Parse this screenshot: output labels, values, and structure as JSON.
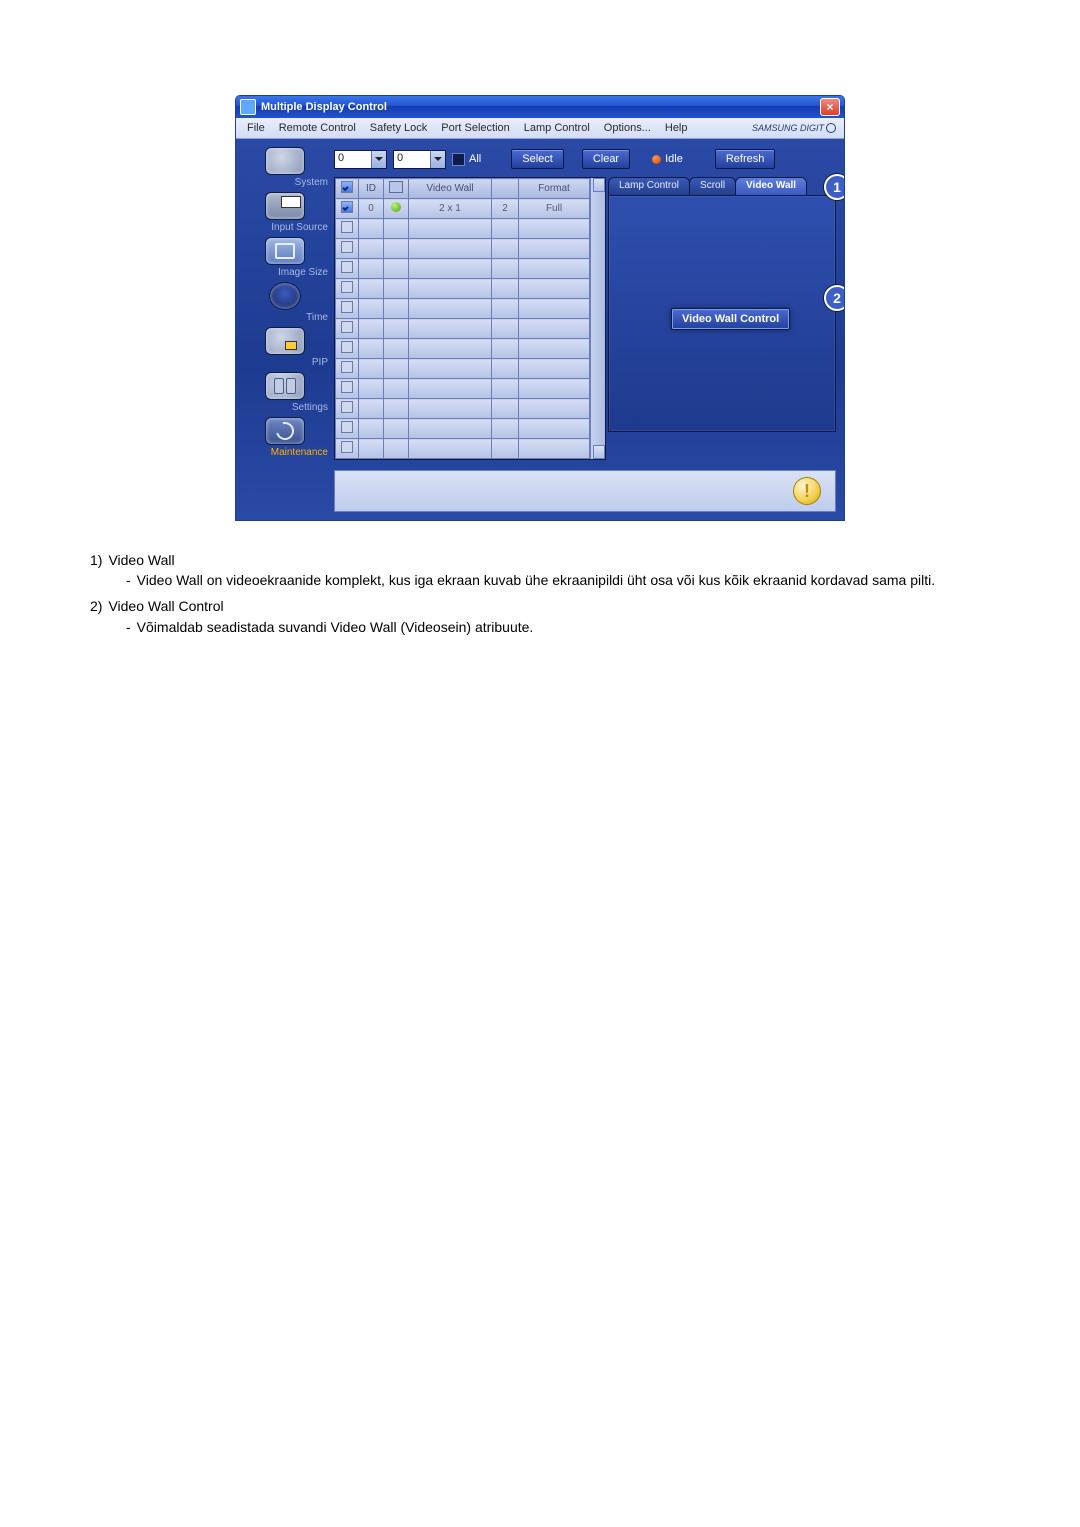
{
  "window": {
    "title": "Multiple Display Control",
    "close": "×"
  },
  "menu": {
    "file": "File",
    "remote": "Remote Control",
    "safety": "Safety Lock",
    "port": "Port Selection",
    "lamp": "Lamp Control",
    "options": "Options...",
    "help": "Help",
    "brand": "SAMSUNG DIGIT"
  },
  "sidebar": {
    "system": "System",
    "input": "Input Source",
    "image": "Image Size",
    "time": "Time",
    "pip": "PIP",
    "settings": "Settings",
    "maintenance": "Maintenance"
  },
  "toolbar": {
    "dd1": "0",
    "dd2": "0",
    "all": "All",
    "select": "Select",
    "clear": "Clear",
    "idle": "Idle",
    "refresh": "Refresh"
  },
  "table": {
    "headers": {
      "id": "ID",
      "videowall": "Video Wall",
      "format": "Format"
    },
    "row": {
      "id": "0",
      "videowall": "2 x 1",
      "n": "2",
      "format": "Full"
    }
  },
  "tabs": {
    "lamp": "Lamp Control",
    "scroll": "Scroll",
    "videowall": "Video Wall"
  },
  "panel": {
    "vw_control": "Video Wall Control"
  },
  "callouts": {
    "c1": "1",
    "c2": "2"
  },
  "status": {
    "exclaim": "!"
  },
  "notes": {
    "n1_num": "1)",
    "n1_title": "Video Wall",
    "n1_dash": "-",
    "n1_body": "Video Wall on videoekraanide komplekt, kus iga ekraan kuvab ühe ekraanipildi üht osa või kus kõik ekraanid kordavad sama pilti.",
    "n2_num": "2)",
    "n2_title": "Video Wall Control",
    "n2_dash": "-",
    "n2_body": "Võimaldab seadistada suvandi Video Wall (Videosein) atribuute."
  }
}
